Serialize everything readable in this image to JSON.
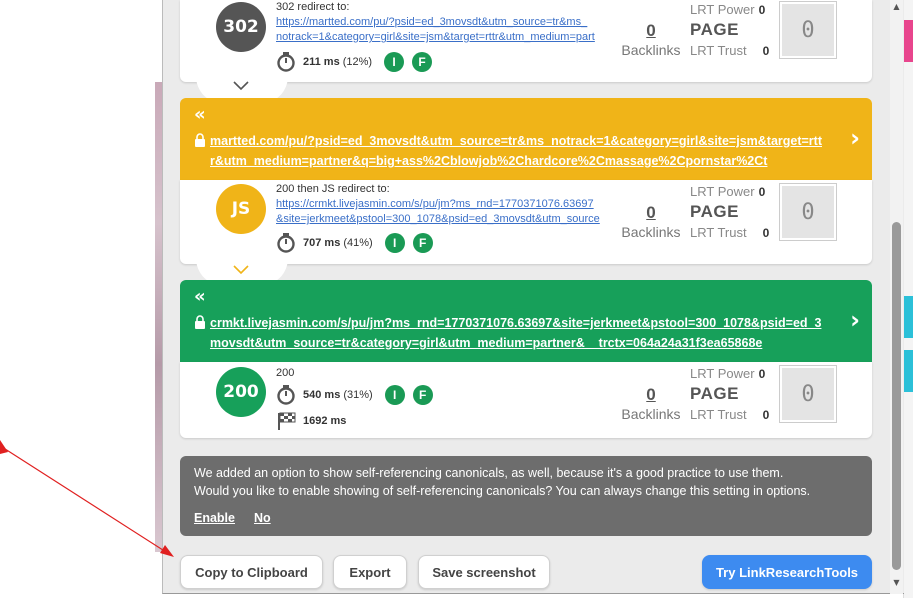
{
  "hops": [
    {
      "code": "302",
      "color": "#555555",
      "status": "302 redirect to:",
      "url_line1": "https://martted.com/pu/?psid=ed_3movsdt&utm_source=tr&ms_",
      "url_line2": "notrack=1&category=girl&site=jsm&target=rttr&utm_medium=part",
      "timing": "211 ms",
      "timing_pct": "(12%)",
      "backlinks": "0",
      "backlinks_label": "Backlinks",
      "lrt_power_label": "LRT Power",
      "lrt_power": "0",
      "page_label": "PAGE",
      "lrt_trust_label": "LRT Trust",
      "lrt_trust": "0",
      "score": "0"
    },
    {
      "code": "JS",
      "color": "#f0b418",
      "status": "200 then JS redirect to:",
      "url_line1": "https://crmkt.livejasmin.com/s/pu/jm?ms_rnd=1770371076.63697",
      "url_line2": "&site=jerkmeet&pstool=300_1078&psid=ed_3movsdt&utm_source",
      "timing": "707 ms",
      "timing_pct": "(41%)",
      "backlinks": "0",
      "backlinks_label": "Backlinks",
      "lrt_power_label": "LRT Power",
      "lrt_power": "0",
      "page_label": "PAGE",
      "lrt_trust_label": "LRT Trust",
      "lrt_trust": "0",
      "score": "0"
    },
    {
      "code": "200",
      "color": "#17a05a",
      "status": "200",
      "timing": "540 ms",
      "timing_pct": "(31%)",
      "total": "1692 ms",
      "backlinks": "0",
      "backlinks_label": "Backlinks",
      "lrt_power_label": "LRT Power",
      "lrt_power": "0",
      "page_label": "PAGE",
      "lrt_trust_label": "LRT Trust",
      "lrt_trust": "0",
      "score": "0"
    }
  ],
  "banners": [
    {
      "color": "#f0b418",
      "back": "«",
      "url": "martted.com/pu/?psid=ed_3movsdt&utm_source=tr&ms_notrack=1&category=girl&site=jsm&target=rttr&utm_medium=partner&q=big+ass%2Cblowjob%2Chardcore%2Cmassage%2Cpornstar%2Ct",
      "next": "›"
    },
    {
      "color": "#17a05a",
      "back": "«",
      "url": "crmkt.livejasmin.com/s/pu/jm?ms_rnd=1770371076.63697&site=jerkmeet&pstool=300_1078&psid=ed_3movsdt&utm_source=tr&category=girl&utm_medium=partner&__trctx=064a24a31f3ea65868e",
      "next": "›"
    }
  ],
  "icons": {
    "stopwatch": "stopwatch-icon",
    "i_button": "I",
    "f_button": "F",
    "flag": "checkered-flag-icon",
    "lock": "lock-icon",
    "chevron": "chevron-down-icon"
  },
  "notice": {
    "line1": "We added an option to show self-referencing canonicals, as well, because it's a good practice to use them.",
    "line2": "Would you like to enable showing of self-referencing canonicals? You can always change this setting in options.",
    "enable": "Enable",
    "no": "No"
  },
  "buttons": {
    "copy": "Copy to Clipboard",
    "export": "Export",
    "screenshot": "Save screenshot",
    "try": "Try LinkResearchTools"
  },
  "colors": {
    "yellow": "#f0b418",
    "green": "#17a05a",
    "gray_circle": "#555555",
    "notice_bg": "#6d6d6d",
    "primary_button": "#3d8bf0"
  }
}
